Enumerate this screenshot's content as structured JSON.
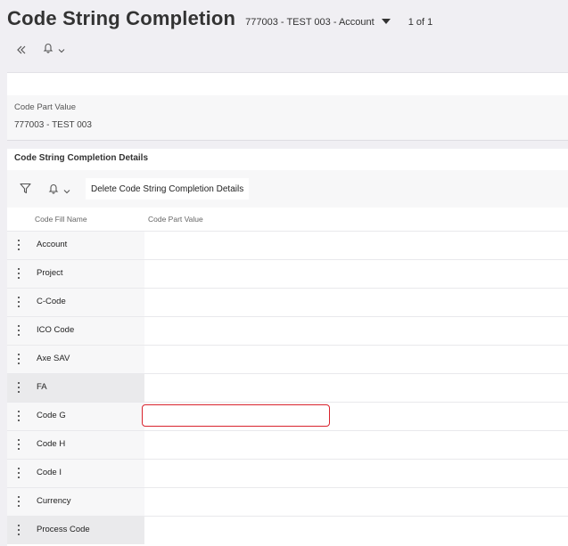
{
  "header": {
    "title": "Code String Completion",
    "record": "777003 - TEST 003 - Account",
    "pager": "1 of 1"
  },
  "card": {
    "label": "Code Part Value",
    "value": "777003 - TEST 003"
  },
  "details": {
    "title": "Code String Completion Details",
    "delete_label": "Delete Code String Completion Details",
    "columns": [
      "Code Fill Name",
      "Code Part Value"
    ],
    "rows": [
      {
        "name": "Account",
        "value": ""
      },
      {
        "name": "Project",
        "value": ""
      },
      {
        "name": "C-Code",
        "value": ""
      },
      {
        "name": "ICO Code",
        "value": ""
      },
      {
        "name": "Axe SAV",
        "value": ""
      },
      {
        "name": "FA",
        "value": ""
      },
      {
        "name": "Code G",
        "value": ""
      },
      {
        "name": "Code H",
        "value": ""
      },
      {
        "name": "Code I",
        "value": ""
      },
      {
        "name": "Currency",
        "value": ""
      },
      {
        "name": "Process Code",
        "value": ""
      }
    ]
  },
  "colors": {
    "background": "#f0eff3",
    "highlight": "#d9232d"
  },
  "icons": [
    "double-chevron-left-icon",
    "bell-icon",
    "chevron-down-icon",
    "filter-icon",
    "caret-down-icon",
    "kebab-icon"
  ]
}
